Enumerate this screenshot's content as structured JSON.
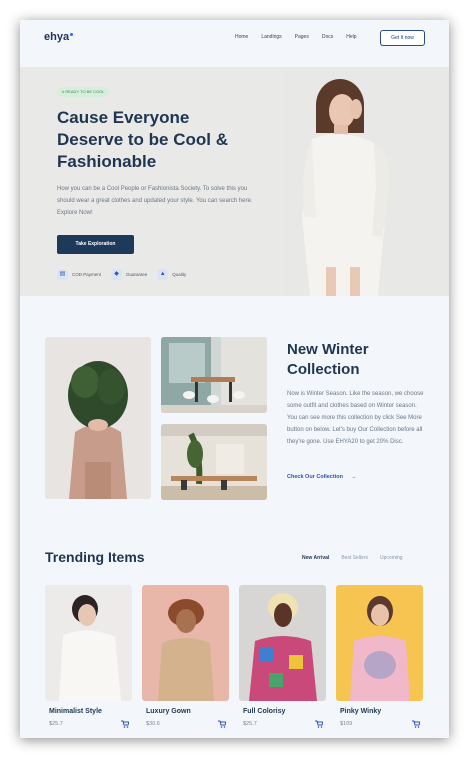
{
  "nav": {
    "logo": "ehya",
    "links": [
      "Home",
      "Landings",
      "Pages",
      "Docs",
      "Help"
    ],
    "cta": "Get It now"
  },
  "hero": {
    "badge": "# READY TO BE COOL",
    "title": "Cause Everyone Deserve to be Cool & Fashionable",
    "description": "How you can be a Cool People or Fashionista Society. To solve this you should wear a great clothes and updated your style. You can search here. Explore Now!",
    "button": "Take Exploration",
    "features": [
      {
        "icon": "cart-icon",
        "label": "COD Payment"
      },
      {
        "icon": "shield-icon",
        "label": "Guarantee"
      },
      {
        "icon": "thumbs-up-icon",
        "label": "Quality"
      }
    ]
  },
  "collection": {
    "title": "New Winter Collection",
    "text": "Now is Winter Season. Like the season, we choose some outfit and clothes based on Winter season. You can see more this collection by click See More button on below. Let's buy Our Collection before all they're gone. Use EHYA20 to get 20% Disc.",
    "link": "Check Our Collection"
  },
  "trending": {
    "title": "Trending Items",
    "tabs": [
      "New Arrival",
      "Best Sellers",
      "Upcoming"
    ],
    "items": [
      {
        "name": "Minimalist Style",
        "price": "$25.7",
        "bg": "#ecebe9"
      },
      {
        "name": "Luxury Gown",
        "price": "$30.6",
        "bg": "#e8b7a9"
      },
      {
        "name": "Full Colorisy",
        "price": "$25.7",
        "bg": "#d8d6d4"
      },
      {
        "name": "Pinky Winky",
        "price": "$109",
        "bg": "#f5c451"
      }
    ]
  },
  "colors": {
    "accent": "#2c4fb5",
    "dark": "#1d3a5a",
    "background": "#f3f7fc"
  }
}
